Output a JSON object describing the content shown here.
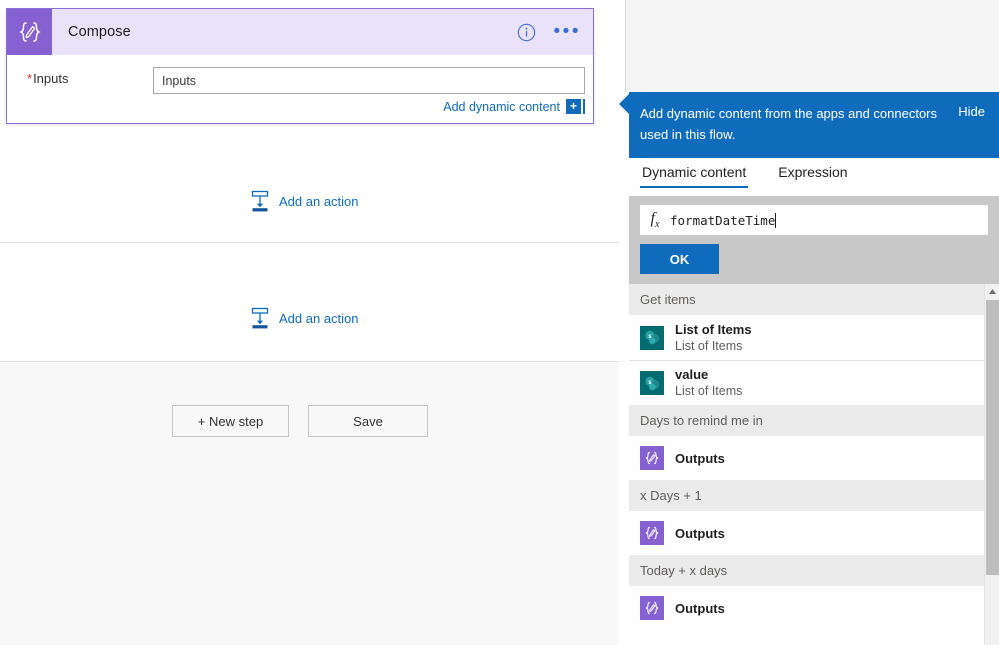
{
  "colors": {
    "accent_blue": "#0f6cbd",
    "compose_purple": "#8661d1",
    "compose_header_bg": "#e9e2f8",
    "sharepoint_teal": "#036C70",
    "group_header_bg": "#ebebeb",
    "expression_area_bg": "#c8c8c8"
  },
  "compose_card": {
    "icon_name": "compose-braces-pencil-icon",
    "title": "Compose",
    "info_icon": "info-circle-icon",
    "more_icon": "ellipsis-icon",
    "input_label": "Inputs",
    "required_marker": "*",
    "input_value": "",
    "input_placeholder": "Inputs",
    "add_dynamic_content_label": "Add dynamic content",
    "add_dynamic_plus_glyph": "+"
  },
  "canvas": {
    "add_action_1": "Add an action",
    "add_action_2": "Add an action",
    "new_step_button": "+ New step",
    "save_button": "Save"
  },
  "dynamic_panel": {
    "banner_text": "Add dynamic content from the apps and connectors used in this flow.",
    "hide_label": "Hide",
    "tabs": [
      {
        "label": "Dynamic content",
        "active": true
      },
      {
        "label": "Expression",
        "active": false
      }
    ],
    "expression": {
      "fx_icon": "fx-function-icon",
      "value": "formatDateTime",
      "ok_button": "OK"
    },
    "groups": [
      {
        "name": "Get items",
        "items": [
          {
            "icon": "sharepoint-icon",
            "title": "List of Items",
            "subtitle": "List of Items"
          },
          {
            "icon": "sharepoint-icon",
            "title": "value",
            "subtitle": "List of Items"
          }
        ]
      },
      {
        "name": "Days to remind me in",
        "items": [
          {
            "icon": "compose-icon",
            "title": "Outputs",
            "subtitle": ""
          }
        ]
      },
      {
        "name": "x Days + 1",
        "items": [
          {
            "icon": "compose-icon",
            "title": "Outputs",
            "subtitle": ""
          }
        ]
      },
      {
        "name": "Today + x days",
        "items": [
          {
            "icon": "compose-icon",
            "title": "Outputs",
            "subtitle": ""
          }
        ]
      }
    ],
    "scrollbar": {
      "up_arrow": "scroll-up-arrow-icon"
    }
  }
}
